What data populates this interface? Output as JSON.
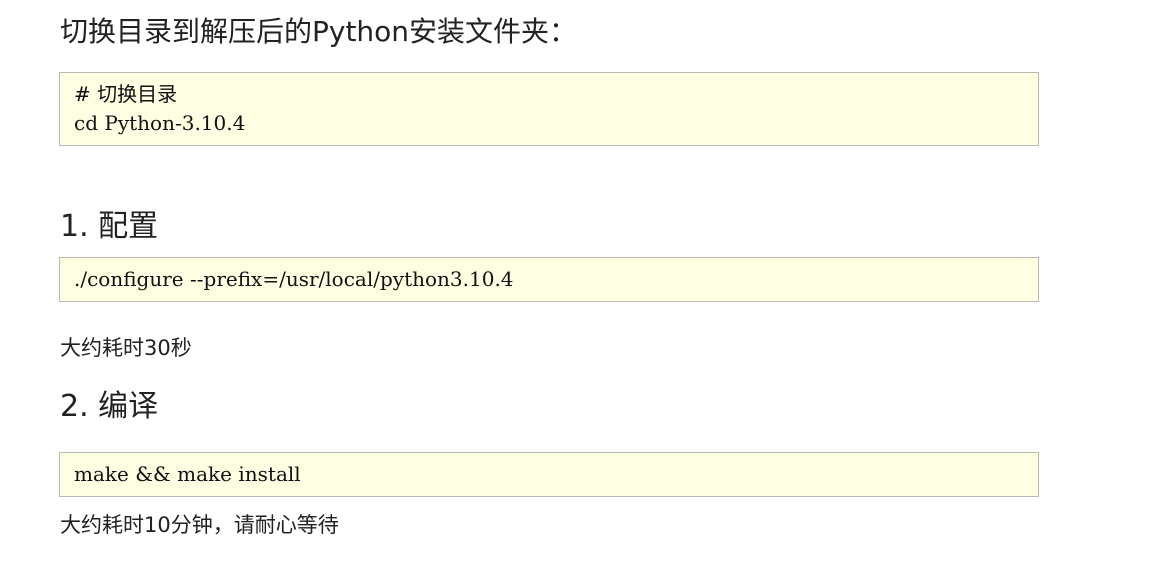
{
  "intro": {
    "heading": "切换目录到解压后的Python安装文件夹："
  },
  "code_cd": {
    "lines": [
      "# 切换目录",
      "cd Python-3.10.4"
    ]
  },
  "step_configure": {
    "heading": "1. 配置",
    "code": "./configure --prefix=/usr/local/python3.10.4",
    "note": "大约耗时30秒"
  },
  "step_compile": {
    "heading": "2. 编译",
    "code": "make && make install",
    "note": "大约耗时10分钟，请耐心等待"
  }
}
